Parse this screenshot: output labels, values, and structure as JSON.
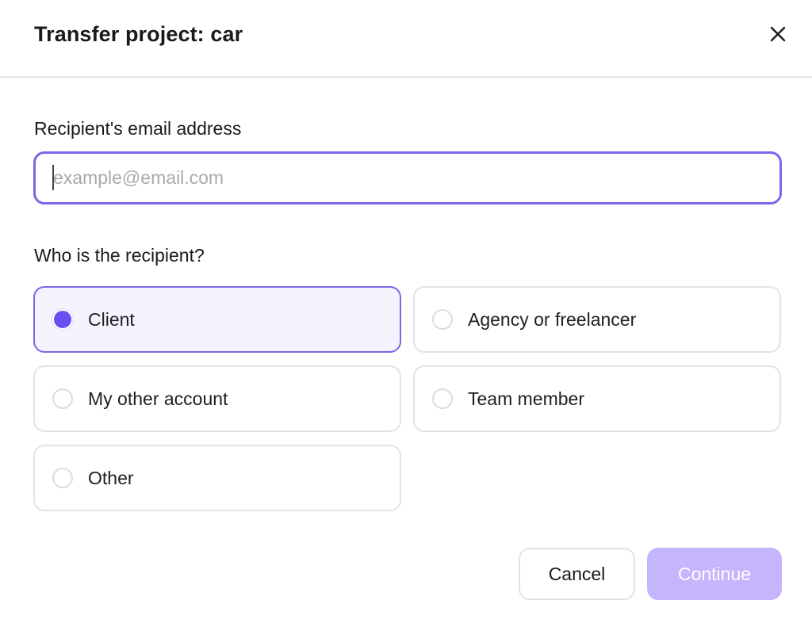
{
  "dialog": {
    "title": "Transfer project: car",
    "close_icon": "close-icon"
  },
  "email": {
    "label": "Recipient's email address",
    "placeholder": "example@email.com",
    "value": ""
  },
  "recipient": {
    "label": "Who is the recipient?",
    "selected": "Client",
    "options": [
      {
        "label": "Client",
        "selected": true
      },
      {
        "label": "Agency or freelancer",
        "selected": false
      },
      {
        "label": "My other account",
        "selected": false
      },
      {
        "label": "Team member",
        "selected": false
      },
      {
        "label": "Other",
        "selected": false
      }
    ]
  },
  "actions": {
    "cancel_label": "Cancel",
    "continue_label": "Continue",
    "continue_disabled": true
  },
  "colors": {
    "accent": "#7b68e8",
    "radio_selected": "#6a4ff0",
    "selected_bg": "#f6f3ff",
    "continue_disabled_bg": "#c4b5fd"
  }
}
